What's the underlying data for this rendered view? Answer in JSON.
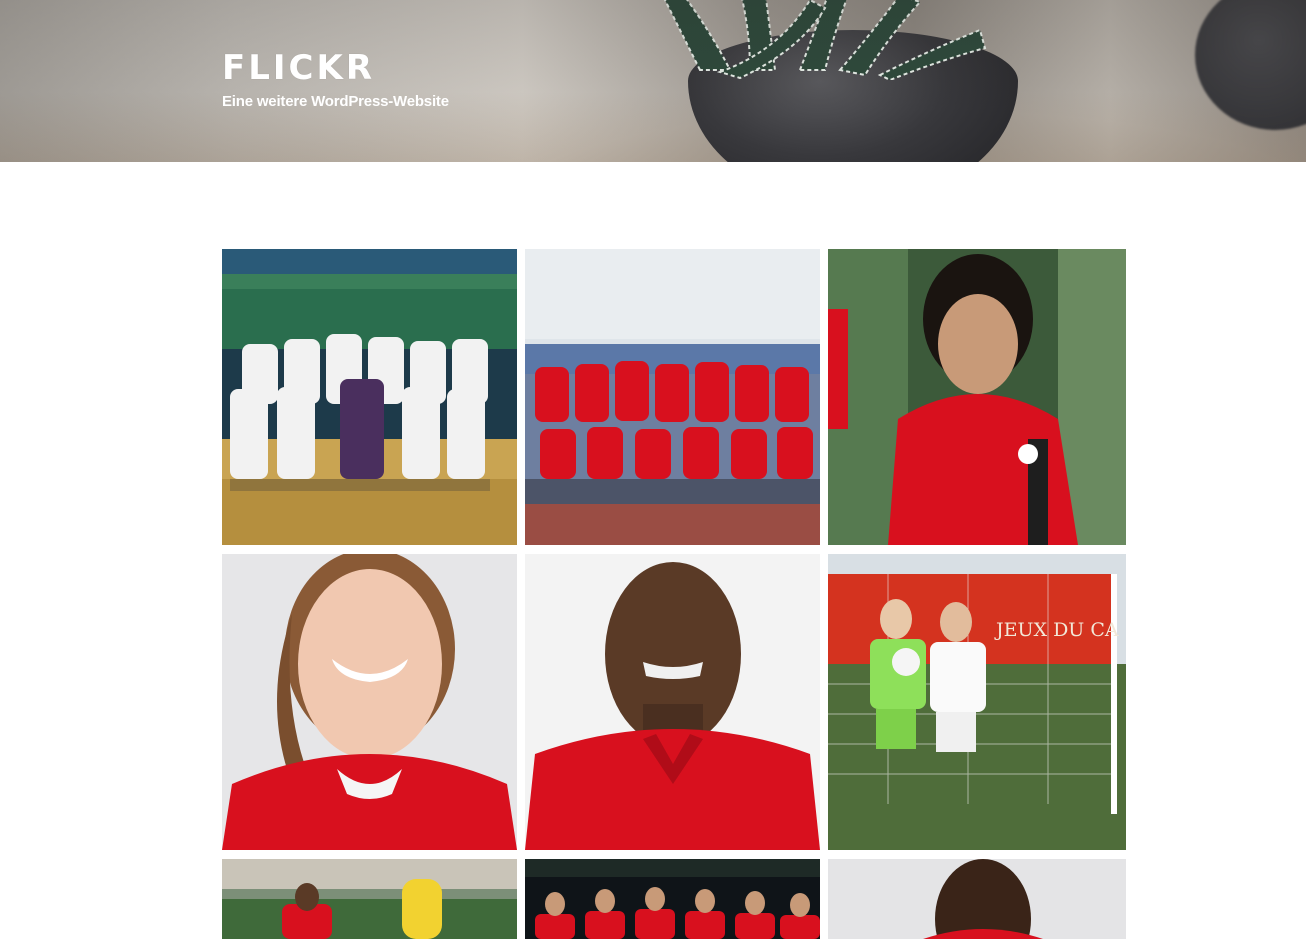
{
  "header": {
    "site_title": "FLICKR",
    "site_description": "Eine weitere WordPress-Website"
  },
  "gallery": {
    "items": [
      {
        "subject": "futsal-team-photo-white-kits"
      },
      {
        "subject": "womens-team-photo-red-training-tops"
      },
      {
        "subject": "player-portrait-curly-hair-red-top"
      },
      {
        "subject": "player-portrait-smiling-woman-red-jersey"
      },
      {
        "subject": "player-portrait-man-red-jersey"
      },
      {
        "subject": "two-players-goal-jeux-du-canada"
      },
      {
        "subject": "player-training-with-yellow-mannequin"
      },
      {
        "subject": "mens-team-photo-night-stadium"
      },
      {
        "subject": "player-portrait-grey-background"
      }
    ],
    "banner_text": "JEUX DU CA"
  },
  "colors": {
    "canada_red": "#d8101e",
    "header_text": "#ffffff"
  }
}
